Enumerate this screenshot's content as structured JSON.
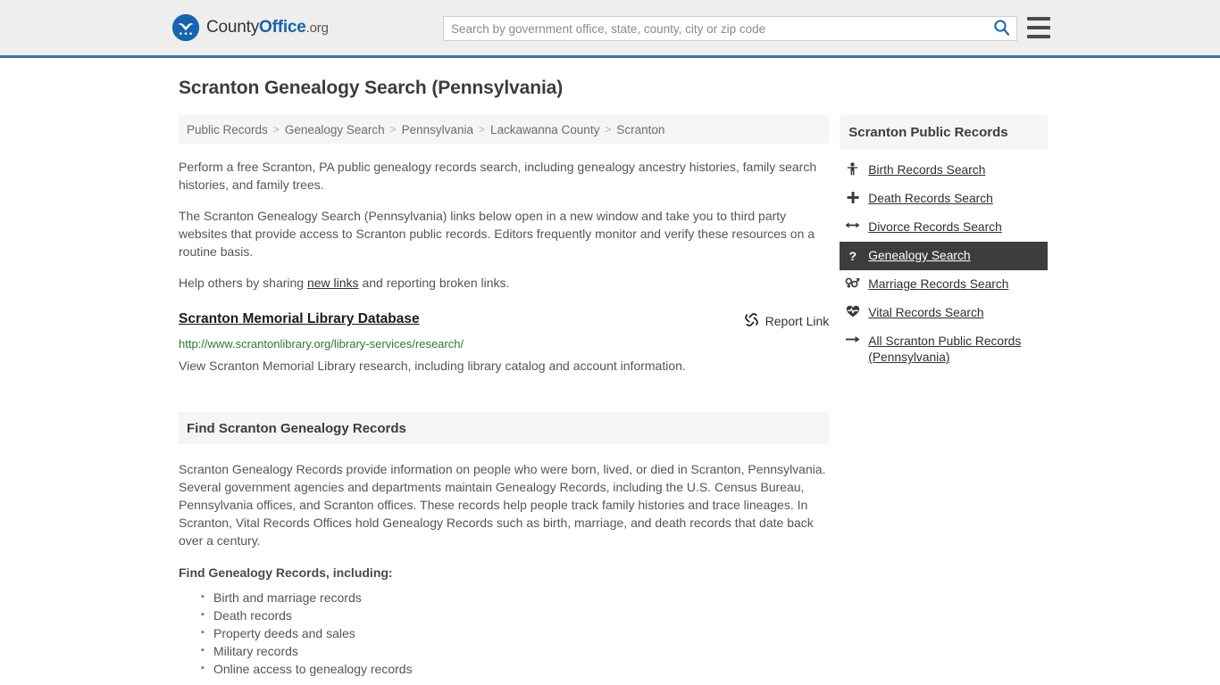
{
  "header": {
    "brand": {
      "part1": "County",
      "part2": "Office",
      "tld": ".org"
    },
    "search": {
      "placeholder": "Search by government office, state, county, city or zip code",
      "value": "",
      "button_name": "search-icon"
    },
    "menu_label": "Menu",
    "accent_color": "#3a73a8",
    "background": "#eeeeec"
  },
  "page": {
    "title": "Scranton Genealogy Search (Pennsylvania)"
  },
  "breadcrumb": {
    "separator": ">",
    "items": [
      {
        "label": "Public Records"
      },
      {
        "label": "Genealogy Search"
      },
      {
        "label": "Pennsylvania"
      },
      {
        "label": "Lackawanna County"
      },
      {
        "label": "Scranton"
      }
    ]
  },
  "intro": {
    "paragraph1": "Perform a free Scranton, PA public genealogy records search, including genealogy ancestry histories, family search histories, and family trees.",
    "paragraph2": "The Scranton Genealogy Search (Pennsylvania) links below open in a new window and take you to third party websites that provide access to Scranton public records. Editors frequently monitor and verify these resources on a routine basis.",
    "paragraph3_before": "Help others by sharing ",
    "paragraph3_link": "new links",
    "paragraph3_after": " and reporting broken links."
  },
  "result": {
    "title": "Scranton Memorial Library Database",
    "url": "http://www.scrantonlibrary.org/library-services/research/",
    "description": "View Scranton Memorial Library research, including library catalog and account information.",
    "report_label": "Report Link",
    "report_icon": "broken-link-icon",
    "url_color": "#2a7a33"
  },
  "section": {
    "heading": "Find Scranton Genealogy Records",
    "paragraph": "Scranton Genealogy Records provide information on people who were born, lived, or died in Scranton, Pennsylvania. Several government agencies and departments maintain Genealogy Records, including the U.S. Census Bureau, Pennsylvania offices, and Scranton offices. These records help people track family histories and trace lineages. In Scranton, Vital Records Offices hold Genealogy Records such as birth, marriage, and death records that date back over a century.",
    "list_heading": "Find Genealogy Records, including:",
    "bullets": [
      "Birth and marriage records",
      "Death records",
      "Property deeds and sales",
      "Military records",
      "Online access to genealogy records"
    ]
  },
  "sidebar": {
    "heading": "Scranton Public Records",
    "active_background": "#3d3d3d",
    "items": [
      {
        "label": "Birth Records Search",
        "icon": "baby-icon",
        "active": false
      },
      {
        "label": "Death Records Search",
        "icon": "cross-icon",
        "active": false
      },
      {
        "label": "Divorce Records Search",
        "icon": "left-right-arrow-icon",
        "active": false
      },
      {
        "label": "Genealogy Search",
        "icon": "question-mark-icon",
        "active": true
      },
      {
        "label": "Marriage Records Search",
        "icon": "gender-symbols-icon",
        "active": false
      },
      {
        "label": "Vital Records Search",
        "icon": "heart-pulse-icon",
        "active": false
      },
      {
        "label": "All Scranton Public Records (Pennsylvania)",
        "icon": "arrow-right-icon",
        "active": false
      }
    ]
  }
}
